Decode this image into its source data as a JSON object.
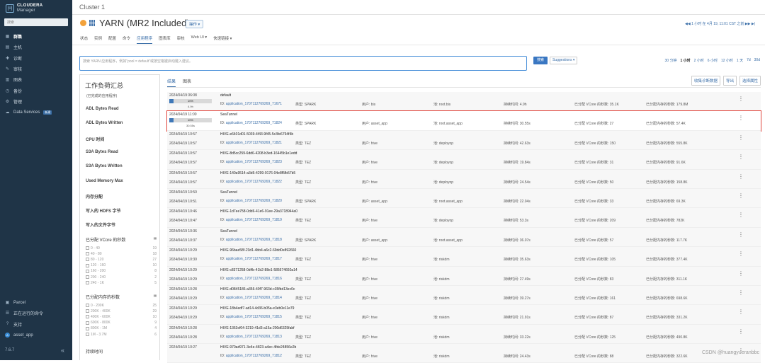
{
  "sidebar": {
    "logo_line1": "CLOUDERA",
    "logo_line2": "Manager",
    "search_placeholder": "搜索",
    "items": [
      {
        "label": "群集",
        "icon": "cluster-icon",
        "active": true
      },
      {
        "label": "主机",
        "icon": "host-icon"
      },
      {
        "label": "诊断",
        "icon": "diagnostics-icon"
      },
      {
        "label": "审核",
        "icon": "audit-icon"
      },
      {
        "label": "图表",
        "icon": "chart-icon"
      },
      {
        "label": "备份",
        "icon": "backup-icon"
      },
      {
        "label": "管理",
        "icon": "gear-icon"
      },
      {
        "label": "Data Services",
        "icon": "data-services-icon",
        "badge": "新建"
      }
    ],
    "bottom": [
      {
        "label": "Parcel",
        "icon": "parcel-icon"
      },
      {
        "label": "正在运行的命令",
        "icon": "commands-icon"
      },
      {
        "label": "支持",
        "icon": "support-icon"
      },
      {
        "label": "asset_app",
        "icon": "user-avatar-icon",
        "avatar": "A"
      }
    ],
    "version": "7.6.7",
    "collapse_glyph": "«"
  },
  "header": {
    "cluster": "Cluster 1",
    "service_title": "YARN (MR2 Included)",
    "operations": "操作 ▾",
    "time_nav": "◀◀  1 小时 在 4月 19, 11:01 CST 之前  ▶▶  ▶|"
  },
  "tabs": [
    "状态",
    "实例",
    "配置",
    "命令",
    "应用程序",
    "图表库",
    "审核",
    "Web UI ▾",
    "快速链接 ▾"
  ],
  "active_tab": 4,
  "search": {
    "placeholder": "搜索 YARN 应用程序，例如\"pool = default\"或按空格键启动键入建议。",
    "button": "搜索",
    "suggestions": "Suggestions ▾"
  },
  "ranges": [
    "30 分钟",
    "1 小时",
    "2 小时",
    "6 小时",
    "12 小时",
    "1 天",
    "7d",
    "30d"
  ],
  "active_range": 1,
  "left_panel": {
    "title": "工作负荷汇总",
    "subtitle": "(已完成的应用程序)",
    "metrics": [
      "ADL Bytes Read",
      "ADL Bytes Written",
      "CPU 时间",
      "S3A Bytes Read",
      "S3A Bytes Written",
      "Used Memory Max",
      "内存分配",
      "写入的 HDFS 字节",
      "写入的文件字节"
    ],
    "vcore_filter": {
      "title": "已分配 VCore 的秒数",
      "rows": [
        {
          "range": "0 - 40",
          "count": "19"
        },
        {
          "range": "40 - 80",
          "count": "18"
        },
        {
          "range": "80 - 120",
          "count": "27"
        },
        {
          "range": "120 - 160",
          "count": "10"
        },
        {
          "range": "160 - 200",
          "count": "8"
        },
        {
          "range": "200 - 240",
          "count": "2"
        },
        {
          "range": "240 - 1K",
          "count": "5"
        }
      ]
    },
    "memory_filter": {
      "title": "已分配内存的秒数",
      "rows": [
        {
          "range": "0 - 200K",
          "count": "25"
        },
        {
          "range": "200K - 400K",
          "count": "29"
        },
        {
          "range": "400K - 600K",
          "count": "10"
        },
        {
          "range": "600K - 800K",
          "count": "9"
        },
        {
          "range": "800K - 1M",
          "count": "4"
        },
        {
          "range": "1M - 3.7M",
          "count": "6"
        }
      ]
    },
    "duration_title": "持续时间"
  },
  "results": {
    "tabs": [
      "结果",
      "图表"
    ],
    "buttons": [
      "收集诊断数据",
      "导出",
      "选择属性"
    ],
    "labels": {
      "id": "ID:",
      "type": "类型:",
      "user": "用户:",
      "pool": "池:",
      "duration": "持续时间:",
      "vcore": "已分配 VCore 的秒数:",
      "mem": "已分配内存的秒数:"
    },
    "rows": [
      {
        "time": "2024/04/19 06:08",
        "name": "default",
        "progress": "10%",
        "progress_value": 0.1,
        "bar_duration": "4.9h",
        "id": "application_1707112769269_71671",
        "type": "SPARK",
        "user": "bis",
        "pool": "root.bis",
        "duration": "4.9h",
        "vcore": "35.1K",
        "mem": "179.8M"
      },
      {
        "time": "2024/04/19 11:00",
        "name": "SeaTunnel",
        "progress": "10%",
        "progress_value": 0.1,
        "bar_duration": "30.55s",
        "id": "application_1707112769269_71824",
        "type": "SPARK",
        "user": "asset_app",
        "pool": "root.asset_app",
        "duration": "30.55s",
        "vcore": "27",
        "mem": "57.4K",
        "highlight": true
      },
      {
        "time": "2024/04/19 10:57",
        "time_end": "2024/04/19 10:57",
        "name": "HIVE-e6401d01-5039-4f43-9f45-5c3fe6794f4b",
        "id": "application_1707112769269_71821",
        "type": "TEZ",
        "user": "hive",
        "pool": "deployop",
        "duration": "42.63s",
        "vcore": "150",
        "mem": "555.8K"
      },
      {
        "time": "2024/04/19 10:57",
        "time_end": "2024/04/19 10:57",
        "name": "HIVE-8d5cc259-6dd6-4208-b3ed-16445b1e1edd",
        "id": "application_1707112769269_71823",
        "type": "TEZ",
        "user": "hive",
        "pool": "deployop",
        "duration": "19.84s",
        "vcore": "31",
        "mem": "91.6K"
      },
      {
        "time": "2024/04/19 10:57",
        "time_end": "2024/04/19 10:57",
        "name": "HIVE-140a9514-a3d6-4299-9176-04e8f5fb57b5",
        "id": "application_1707112769269_71822",
        "type": "TEZ",
        "user": "hive",
        "pool": "deployop",
        "duration": "24.54s",
        "vcore": "50",
        "mem": "158.8K"
      },
      {
        "time": "2024/04/19 10:50",
        "time_end": "2024/04/19 10:51",
        "name": "SeaTunnel",
        "id": "application_1707112769269_71820",
        "type": "SPARK",
        "user": "asset_app",
        "pool": "root.asset_app",
        "duration": "22.04s",
        "vcore": "33",
        "mem": "69.3K"
      },
      {
        "time": "2024/04/19 10:46",
        "time_end": "2024/04/19 10:47",
        "name": "HIVE-1d7ee758-0dd6-41e6-91ee-29a3718944a0",
        "id": "application_1707112769269_71819",
        "type": "TEZ",
        "user": "hive",
        "pool": "deployop",
        "duration": "53.3s",
        "vcore": "209",
        "mem": "782K"
      },
      {
        "time": "2024/04/19 10:36",
        "time_end": "2024/04/19 10:37",
        "name": "SeaTunnel",
        "id": "application_1707112769269_71818",
        "type": "SPARK",
        "user": "asset_app",
        "pool": "root.asset_app",
        "duration": "36.07s",
        "vcore": "57",
        "mem": "117.7K"
      },
      {
        "time": "2024/04/19 10:29",
        "time_end": "2024/04/19 10:30",
        "name": "HIVE-96bae58f-23d1-4bb4-a6c2-69dd0e892660",
        "id": "application_1707112769269_71817",
        "type": "TEZ",
        "user": "hive",
        "pool": "riskdm",
        "duration": "35.63s",
        "vcore": "105",
        "mem": "377.4K"
      },
      {
        "time": "2024/04/19 10:29",
        "time_end": "2024/04/19 10:29",
        "name": "HIVE-c8371258-0d4b-41b2-88e1-585674660a14",
        "id": "application_1707112769269_71816",
        "type": "TEZ",
        "user": "hive",
        "pool": "riskdm",
        "duration": "27.49s",
        "vcore": "83",
        "mem": "311.1K"
      },
      {
        "time": "2024/04/19 10:28",
        "time_end": "2024/04/19 10:29",
        "name": "HIVE-d0845186-a356-49f7-963d-c35fbd13ec0c",
        "id": "application_1707112769269_71814",
        "type": "TEZ",
        "user": "hive",
        "pool": "riskdm",
        "duration": "39.27s",
        "vcore": "161",
        "mem": "698.6K"
      },
      {
        "time": "2024/04/19 10:29",
        "time_end": "2024/04/19 10:29",
        "name": "HIVE-18b4edf7-ad14-4d36-b05a-e3eb0e11e79",
        "id": "application_1707112769269_71815",
        "type": "TEZ",
        "user": "hive",
        "pool": "riskdm",
        "duration": "21.91s",
        "vcore": "87",
        "mem": "331.2K"
      },
      {
        "time": "2024/04/19 10:28",
        "time_end": "2024/04/19 10:28",
        "name": "HIVE-1363cf04-3219-41d3-a15a-200d6325fabf",
        "id": "application_1707112769269_71813",
        "type": "TEZ",
        "user": "hive",
        "pool": "riskdm",
        "duration": "33.22s",
        "vcore": "125",
        "mem": "490.8K"
      },
      {
        "time": "2024/04/19 10:27",
        "name": "HIVE-970ad971-3e4e-4823-a4ec-4fde24856e2b",
        "id": "application_1707112769269_71812",
        "type": "TEZ",
        "user": "hive",
        "pool": "riskdm",
        "duration": "24.43s",
        "vcore": "88",
        "mem": "322.6K"
      }
    ]
  },
  "watermark": "CSDN @huangyueranbbc",
  "colors": {
    "sidebar": "#1f3447",
    "accent": "#3a6ea8",
    "highlight": "#e0443b",
    "service_dot": "#f2a23c"
  }
}
